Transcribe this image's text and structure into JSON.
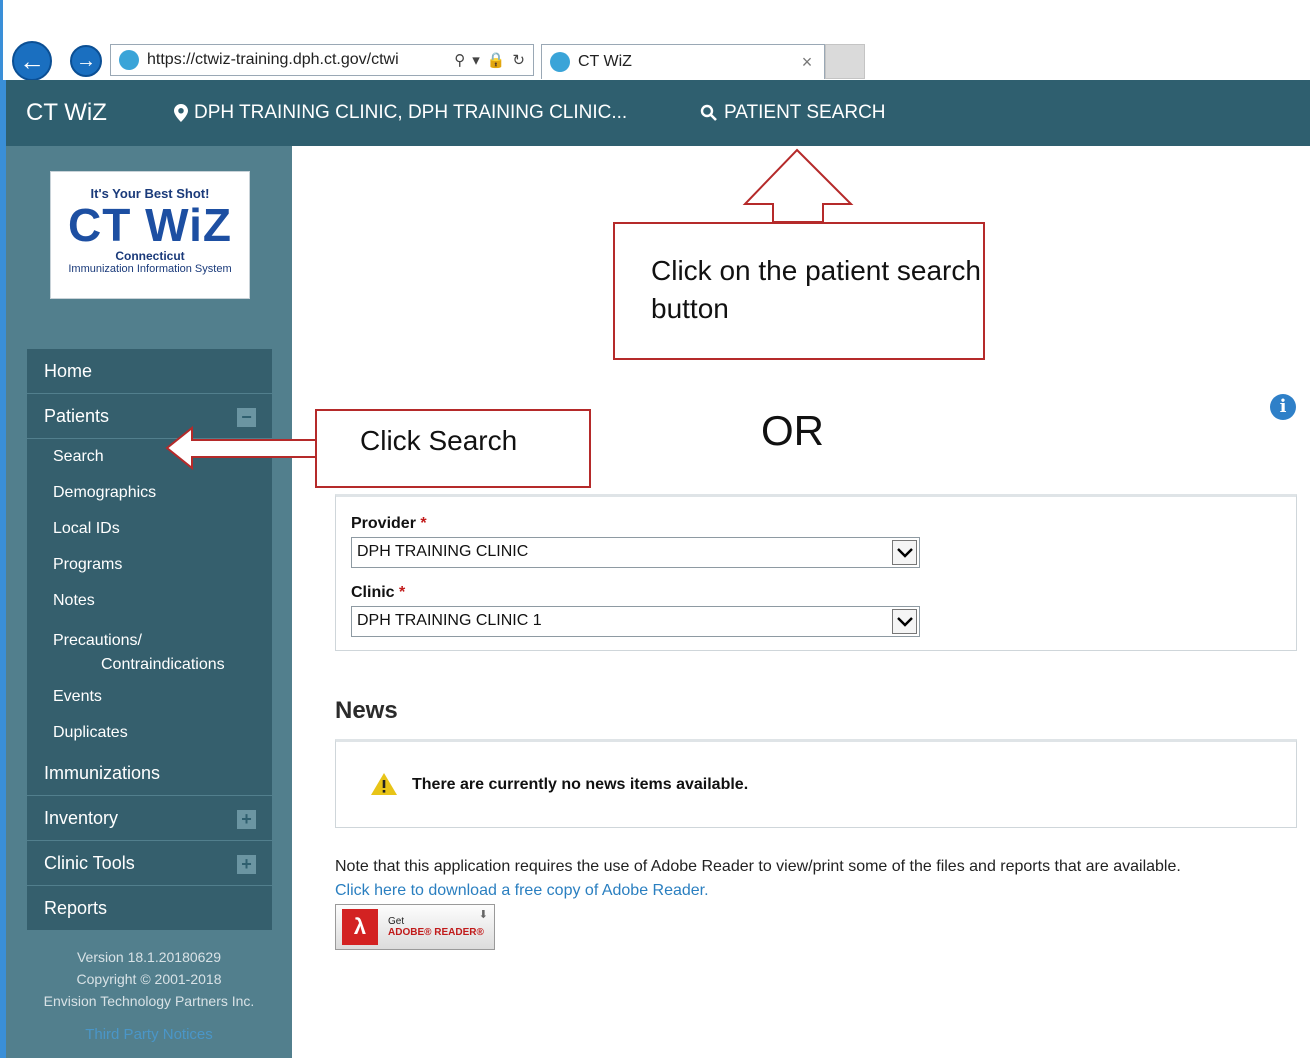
{
  "browser": {
    "url": "https://ctwiz-training.dph.ct.gov/ctwi",
    "tab_title": "CT WiZ",
    "tab_close": "×"
  },
  "header": {
    "app_title": "CT WiZ",
    "clinic": "DPH TRAINING CLINIC, DPH TRAINING CLINIC...",
    "patient_search": "PATIENT SEARCH"
  },
  "logo": {
    "tagline": "It's Your Best Shot!",
    "name": "CT WiZ",
    "subtitle1": "Connecticut",
    "subtitle2": "Immunization Information System"
  },
  "sidebar": {
    "home": "Home",
    "patients": "Patients",
    "patients_sub": [
      "Search",
      "Demographics",
      "Local IDs",
      "Programs",
      "Notes"
    ],
    "precautions_line1": "Precautions/",
    "precautions_line2": "Contraindications",
    "patients_sub2": [
      "Events",
      "Duplicates"
    ],
    "immunizations": "Immunizations",
    "inventory": "Inventory",
    "clinic_tools": "Clinic Tools",
    "reports": "Reports",
    "version": "Version 18.1.20180629",
    "copyright": "Copyright © 2001-2018",
    "company": "Envision Technology Partners Inc.",
    "third_party": "Third Party Notices"
  },
  "annotations": {
    "patient_search_callout": "Click on the patient search button",
    "search_callout": "Click Search",
    "or": "OR"
  },
  "form": {
    "provider_label": "Provider",
    "provider_value": "DPH TRAINING CLINIC",
    "clinic_label": "Clinic",
    "clinic_value": "DPH TRAINING CLINIC 1",
    "required_mark": "*"
  },
  "news": {
    "title": "News",
    "message": "There are currently no news items available."
  },
  "footer": {
    "note": "Note that this application requires the use of Adobe Reader to view/print some of the files and reports that are available.",
    "link": "Click here to download a free copy of Adobe Reader.",
    "badge_get": "Get",
    "badge_product": "ADOBE® READER®"
  },
  "colors": {
    "header_bg": "#2f5f6f",
    "sidebar_bg": "#527f8d",
    "menu_bg": "#355f6d",
    "callout_border": "#b52a2a",
    "link": "#2a7fc0"
  }
}
